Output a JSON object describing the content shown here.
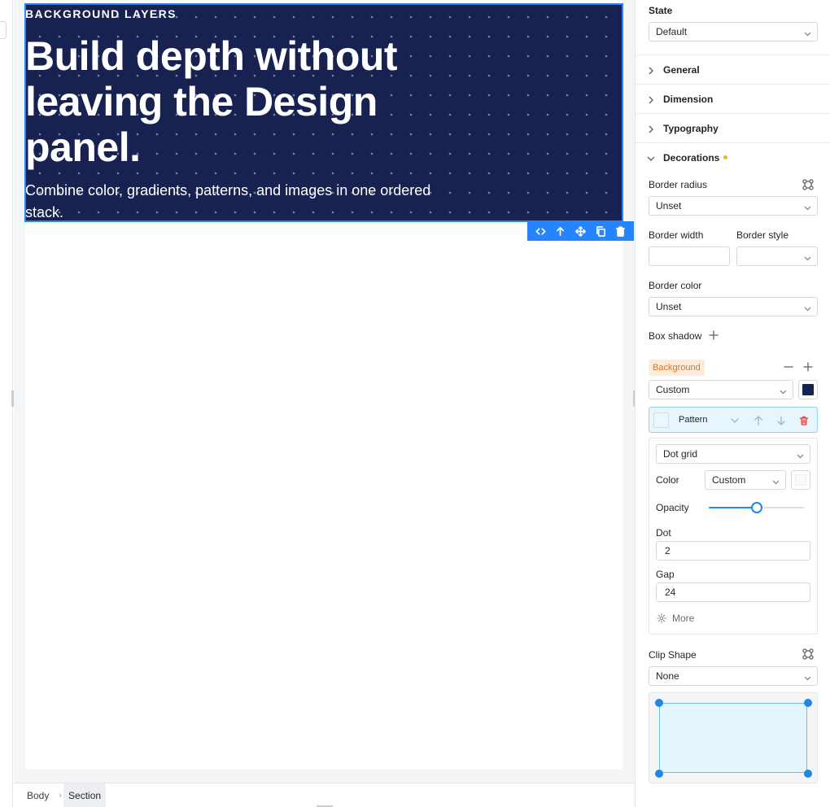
{
  "canvas": {
    "hero": {
      "eyebrow": "BACKGROUND LAYERS",
      "title": "Build depth without leaving the Design panel.",
      "subtitle": "Combine color, gradients, patterns, and images in one ordered stack."
    },
    "toolbar": [
      "code-icon",
      "arrow-up-icon",
      "move-icon",
      "duplicate-icon",
      "trash-icon"
    ]
  },
  "breadcrumb": {
    "items": [
      "Body",
      "Section"
    ]
  },
  "panel": {
    "state": {
      "label": "State",
      "value": "Default"
    },
    "sections": {
      "general": "General",
      "dimension": "Dimension",
      "typography": "Typography",
      "decorations": "Decorations"
    },
    "border_radius": {
      "label": "Border radius",
      "value": "Unset"
    },
    "border_width": {
      "label": "Border width",
      "value": ""
    },
    "border_style": {
      "label": "Border style",
      "value": ""
    },
    "border_color": {
      "label": "Border color",
      "value": "Unset"
    },
    "box_shadow": {
      "label": "Box shadow"
    },
    "background": {
      "label": "Background",
      "mode": "Custom",
      "color": "#172251",
      "layer": {
        "name": "Pattern",
        "pattern_type": "Dot grid",
        "color_label": "Color",
        "color_mode": "Custom",
        "opacity_label": "Opacity",
        "opacity": 0.5,
        "dot_label": "Dot",
        "dot": "2",
        "gap_label": "Gap",
        "gap": "24",
        "more": "More"
      }
    },
    "clip_shape": {
      "label": "Clip Shape",
      "value": "None"
    }
  },
  "colors": {
    "accent": "#2684ff",
    "badge": "#f5b21b",
    "hero_bg": "#172251",
    "danger": "#e53935"
  }
}
